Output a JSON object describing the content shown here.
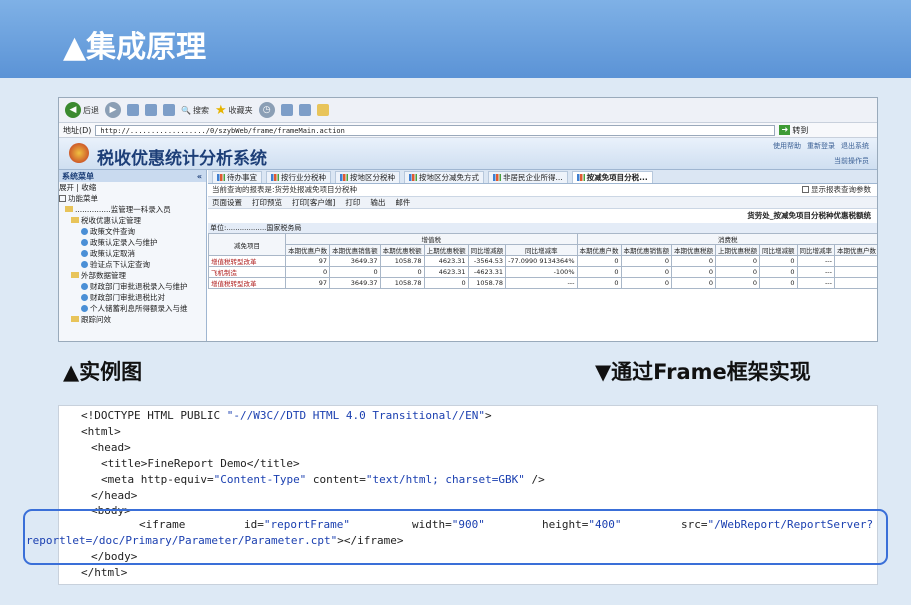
{
  "slide": {
    "title": "▲集成原理"
  },
  "browser": {
    "back_label": "后退",
    "search_label": "搜索",
    "favorites_label": "收藏夹",
    "address_label": "地址(D)",
    "url": "http://................../0/szybWeb/frame/frameMain.action",
    "go_label": "转到"
  },
  "app": {
    "title": "税收优惠统计分析系统",
    "links": [
      "使用帮助",
      "重新登录",
      "退出系统"
    ],
    "operator": "当前操作员"
  },
  "sidebar": {
    "header": "系统菜单",
    "items": [
      "展开 | 收缩",
      "功能菜单",
      "...............监管理一科录入员",
      "税收优惠认定管理",
      "政策文件查询",
      "政策认定录入与维护",
      "政策认定取消",
      "验证点下认定查询",
      "外部数据管理",
      "财政部门审批退税录入与维护",
      "财政部门审批退税比对",
      "个人储蓄利息所得额录入与维",
      "跟踪问效"
    ]
  },
  "tabs": [
    "待办事宜",
    "按行业分税种",
    "按地区分税种",
    "按地区分减免方式",
    "非居民企业所得...",
    "按减免项目分税..."
  ],
  "query_info": "当前查询的报表是:货劳处报减免项目分税种",
  "show_params": "显示报表查询参数",
  "actions": [
    "页面设置",
    "打印预览",
    "打印[客户端]",
    "打印",
    "输出",
    "邮件"
  ],
  "report": {
    "title": "货劳处_按减免项目分税种优惠税额统",
    "unit": "单位:..................国家税务局",
    "group1": "增值税",
    "group2": "消费税",
    "col_item": "减免项目",
    "cols1": [
      "本期优惠户数",
      "本期优惠销售额",
      "本期优惠税额",
      "上期优惠税额",
      "同比增减额",
      "同比增减率"
    ],
    "cols2": [
      "本期优惠户数",
      "本期优惠销售额",
      "本期优惠税额",
      "上期优惠税额",
      "同比增减额",
      "同比增减率",
      "本期优惠户数"
    ],
    "rows": [
      {
        "name": "增值税转型改革",
        "v": [
          "97",
          "3649.37",
          "1058.78",
          "4623.31",
          "-3564.53",
          "-77.0990 9134364%"
        ],
        "w": [
          "0",
          "0",
          "0",
          "0",
          "0",
          "---",
          ""
        ]
      },
      {
        "name": "飞机制造",
        "v": [
          "0",
          "0",
          "0",
          "4623.31",
          "-4623.31",
          "-100%"
        ],
        "w": [
          "0",
          "0",
          "0",
          "0",
          "0",
          "---",
          ""
        ]
      },
      {
        "name": "增值税转型改革",
        "v": [
          "97",
          "3649.37",
          "1058.78",
          "0",
          "1058.78",
          "---"
        ],
        "w": [
          "0",
          "0",
          "0",
          "0",
          "0",
          "---",
          ""
        ]
      }
    ]
  },
  "labels": {
    "left": "▲实例图",
    "right": "▼通过Frame框架实现"
  },
  "code": {
    "line1_a": "<!DOCTYPE HTML PUBLIC ",
    "line1_b": "\"-//W3C//DTD HTML 4.0 Transitional//EN\"",
    "line1_c": ">",
    "line2": "<html>",
    "line3": "<head>",
    "line4": "<title>FineReport Demo</title>",
    "line5_a": "<meta http-equiv=",
    "line5_b": "\"Content-Type\"",
    "line5_c": " content=",
    "line5_d": "\"text/html; charset=GBK\"",
    "line5_e": " />",
    "line6": "</head>",
    "line7": "<body>",
    "line8_a": "<iframe",
    "line8_b": "id=",
    "line8_c": "\"reportFrame\"",
    "line8_d": "width=",
    "line8_e": "\"900\"",
    "line8_f": "height=",
    "line8_g": "\"400\"",
    "line8_h": "src=",
    "line8_i": "\"/WebReport/ReportServer?",
    "line9_a": "reportlet=/doc/Primary/Parameter/Parameter.cpt\"",
    "line9_b": "></iframe>",
    "line10": "</body>",
    "line11": "</html>"
  }
}
